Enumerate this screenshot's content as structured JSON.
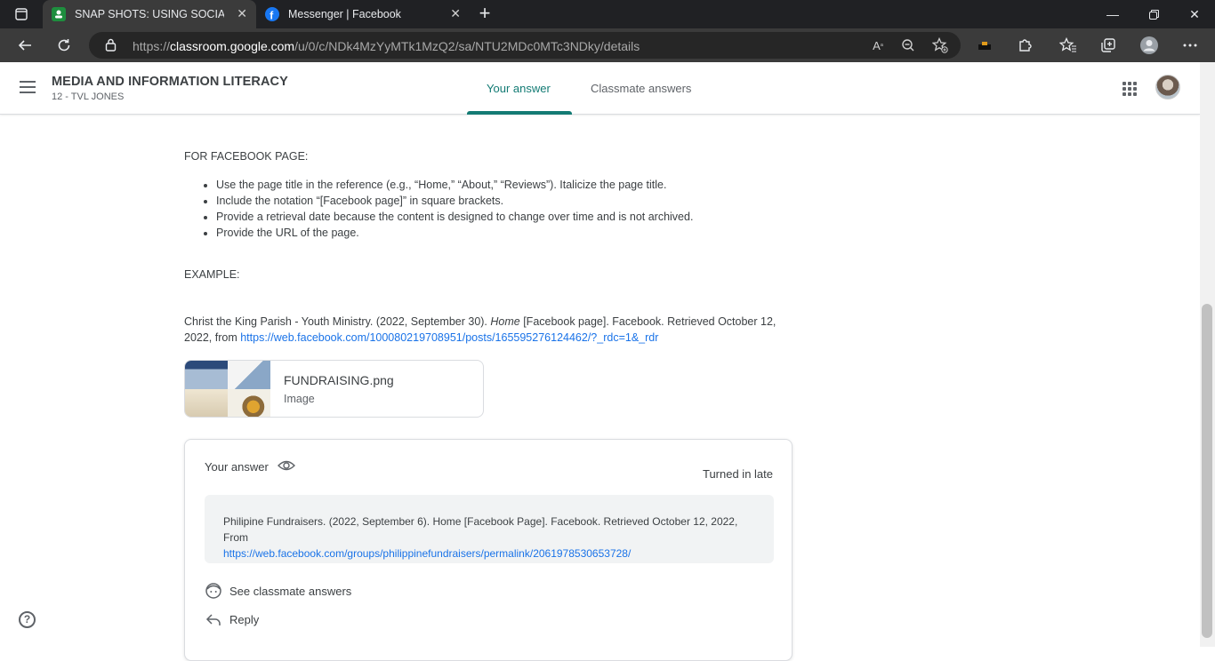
{
  "browser": {
    "tabs": [
      {
        "title": "SNAP SHOTS: USING SOCIAL MEDIA",
        "favicon": "classroom-icon",
        "active": true
      },
      {
        "title": "Messenger | Facebook",
        "favicon": "facebook-icon",
        "active": false
      }
    ],
    "url_prefix": "https://",
    "url_host": "classroom.google.com",
    "url_path": "/u/0/c/NDk4MzYyMTk1MzQ2/sa/NTU2MDc0MTc3NDky/details",
    "colors": {
      "tab_bg": "#202124",
      "active_tab": "#3b3b3b",
      "omnibox": "#262626"
    }
  },
  "header": {
    "class_title": "MEDIA AND INFORMATION LITERACY",
    "class_section": "12 - TVL JONES",
    "tabs": [
      {
        "label": "Your answer",
        "active": true
      },
      {
        "label": "Classmate answers",
        "active": false
      }
    ],
    "accent_color": "#137b74"
  },
  "content": {
    "section_heading": "FOR FACEBOOK PAGE:",
    "bullets": [
      "Use the page title in the reference (e.g., “Home,” “About,” “Reviews”). Italicize the page title.",
      "Include the notation “[Facebook page]” in square brackets.",
      "Provide a retrieval date because the content is designed to change over time and is not archived.",
      "Provide the URL of the page."
    ],
    "example_label": "EXAMPLE:",
    "reference": {
      "before": "Christ the King Parish - Youth Ministry. (2022, September 30). ",
      "italic": "Home",
      "after": " [Facebook page]. Facebook. Retrieved October 12, 2022, from ",
      "link": "https://web.facebook.com/100080219708951/posts/165595276124462/?_rdc=1&_rdr"
    },
    "attachment": {
      "name": "FUNDRAISING.png",
      "type": "Image"
    }
  },
  "answer_card": {
    "title": "Your answer",
    "status": "Turned in late",
    "answer_text": "Philipine Fundraisers. (2022, September 6). Home [Facebook Page]. Facebook. Retrieved October 12, 2022, From",
    "answer_link": "https://web.facebook.com/groups/philippinefundraisers/permalink/2061978530653728/",
    "see_classmates": "See classmate answers",
    "reply": "Reply"
  },
  "help": {
    "label": "?"
  }
}
